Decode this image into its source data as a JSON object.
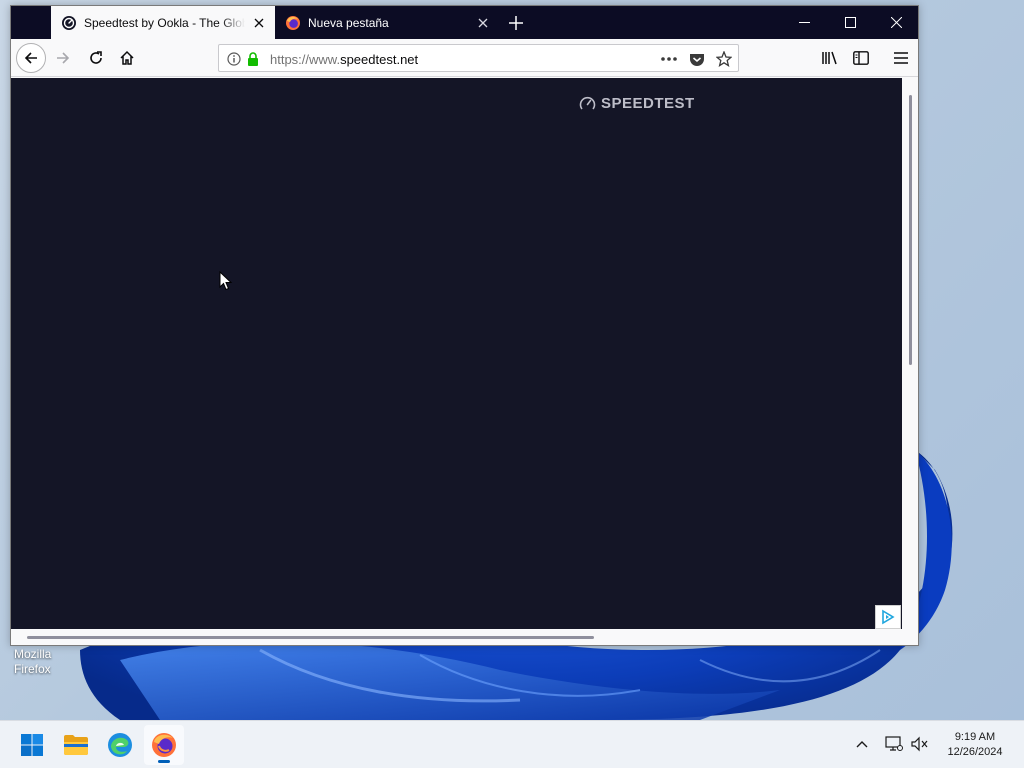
{
  "desktop": {
    "icon_label_line1": "Mozilla",
    "icon_label_line2": "Firefox"
  },
  "browser": {
    "tabs": [
      {
        "title": "Speedtest by Ookla - The Global Broadband Speed Test",
        "active": true
      },
      {
        "title": "Nueva pestaña",
        "active": false
      }
    ],
    "url": {
      "prefix": "https://www.",
      "domain": "speedtest.net"
    },
    "page": {
      "logo_text": "SPEEDTEST",
      "background_color": "#141526"
    }
  },
  "taskbar": {
    "apps": [
      {
        "name": "Start",
        "icon": "windows-start-icon"
      },
      {
        "name": "File Explorer",
        "icon": "folder-icon"
      },
      {
        "name": "Microsoft Edge",
        "icon": "edge-icon"
      },
      {
        "name": "Firefox",
        "icon": "firefox-icon",
        "active": true
      }
    ],
    "clock": {
      "time": "9:19 AM",
      "date": "12/26/2024"
    }
  },
  "colors": {
    "tabstrip": "#0c0c24",
    "accent": "#005fb8",
    "secure_lock": "#12bc00"
  }
}
